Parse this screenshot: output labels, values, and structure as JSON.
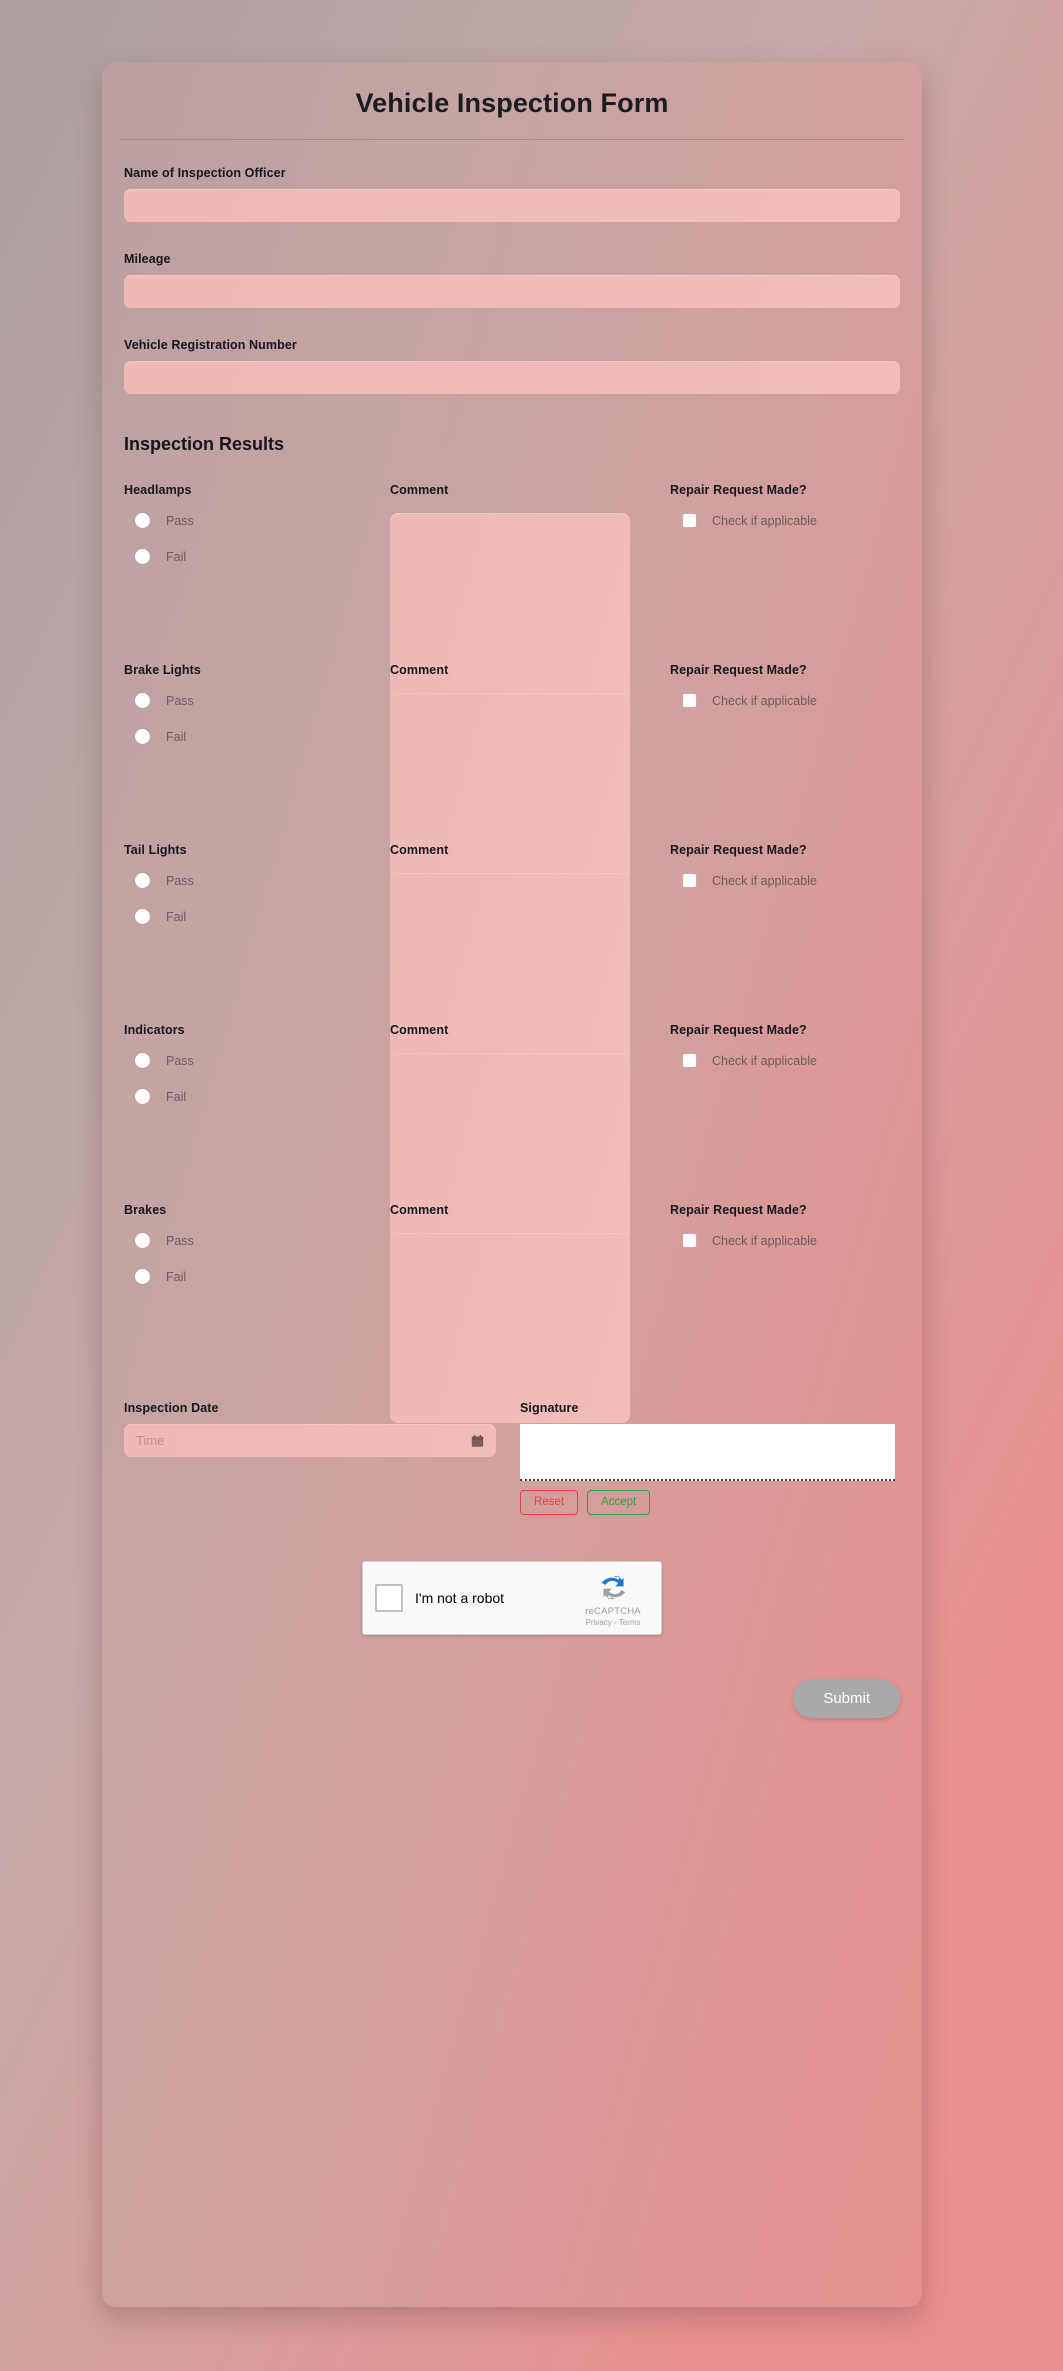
{
  "form": {
    "title": "Vehicle Inspection Form",
    "section_heading": "Inspection Results",
    "fields": [
      {
        "label": "Name of Inspection Officer",
        "value": "",
        "placeholder": ""
      },
      {
        "label": "Mileage",
        "value": "",
        "placeholder": ""
      },
      {
        "label": "Vehicle Registration Number",
        "value": "",
        "placeholder": ""
      }
    ],
    "column_headers": {
      "comment": "Comment",
      "repair": "Repair Request Made?"
    },
    "radio_options": {
      "pass": "Pass",
      "fail": "Fail"
    },
    "checkbox_label": "Check if applicable",
    "inspection_items": [
      {
        "label": "Headlamps",
        "comment": "",
        "repair_checked": false,
        "selected": ""
      },
      {
        "label": "Brake Lights",
        "comment": "",
        "repair_checked": false,
        "selected": ""
      },
      {
        "label": "Tail Lights",
        "comment": "",
        "repair_checked": false,
        "selected": ""
      },
      {
        "label": "Indicators",
        "comment": "",
        "repair_checked": false,
        "selected": ""
      },
      {
        "label": "Brakes",
        "comment": "",
        "repair_checked": false,
        "selected": ""
      }
    ],
    "date": {
      "label": "Inspection Date",
      "value": "",
      "placeholder": "Time",
      "icon": "calendar-icon"
    },
    "signature": {
      "label": "Signature",
      "reset_label": "Reset",
      "accept_label": "Accept"
    },
    "captcha": {
      "label": "I'm not a robot",
      "brand": "reCAPTCHA",
      "legal": "Privacy - Terms",
      "icon": "recaptcha-logo-icon"
    },
    "submit_label": "Submit"
  },
  "colors": {
    "background_start": "#ada0a0",
    "background_end": "#ea908e",
    "card": "#c4a4a3",
    "input": "#f0bab7",
    "title_text": "#1b1b22",
    "muted_text": "#6e5b5d",
    "reset": "#e0453f",
    "accept": "#2aa33a",
    "submit": "#a9a9a9"
  }
}
